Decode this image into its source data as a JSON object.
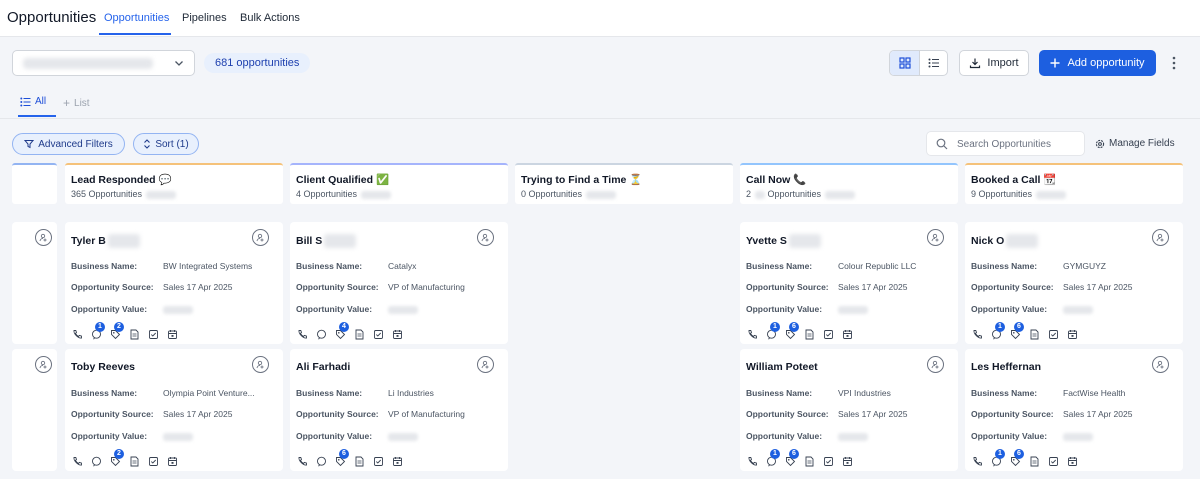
{
  "header": {
    "title": "Opportunities",
    "tabs": [
      {
        "label": "Opportunities",
        "active": true
      },
      {
        "label": "Pipelines",
        "active": false
      },
      {
        "label": "Bulk Actions",
        "active": false
      }
    ]
  },
  "toolbar": {
    "count_label": "681 opportunities",
    "import_label": "Import",
    "add_label": "Add opportunity"
  },
  "views": {
    "all_label": "All",
    "list_label": "List"
  },
  "filters": {
    "advanced_label": "Advanced Filters",
    "sort_label": "Sort (1)",
    "search_placeholder": "Search Opportunities",
    "manage_fields_label": "Manage Fields"
  },
  "field_labels": {
    "business_name": "Business Name:",
    "opportunity_source": "Opportunity Source:",
    "opportunity_value": "Opportunity Value:"
  },
  "stages": [
    {
      "name": "Lead Responded",
      "emoji": "💬",
      "count_text": "365 Opportunities"
    },
    {
      "name": "Client Qualified",
      "emoji": "✅",
      "count_text": "4 Opportunities"
    },
    {
      "name": "Trying to Find a Time",
      "emoji": "⏳",
      "count_text": "0 Opportunities"
    },
    {
      "name": "Call Now",
      "emoji": "📞",
      "count_text": "2",
      "count_suffix": "Opportunities"
    },
    {
      "name": "Booked a Call",
      "emoji": "📆",
      "count_text": "9",
      "count_suffix": "Opportunities"
    }
  ],
  "cards": {
    "col0_row0": {
      "name": "Tyler B",
      "business": "BW Integrated Systems",
      "source": "Sales 17 Apr 2025",
      "badges": [
        "",
        "1",
        "2",
        "",
        "",
        ""
      ]
    },
    "col0_row1": {
      "name": "Toby Reeves",
      "business": "Olympia Point Venture...",
      "source": "Sales 17 Apr 2025",
      "badges": [
        "",
        "",
        "2",
        "",
        "",
        ""
      ]
    },
    "col1_row0": {
      "name": "Bill S",
      "business": "Catalyx",
      "source": "VP of Manufacturing",
      "badges": [
        "",
        "",
        "4",
        "",
        "",
        ""
      ]
    },
    "col1_row1": {
      "name": "Ali Farhadi",
      "business": "Li Industries",
      "source": "VP of Manufacturing",
      "badges": [
        "",
        "",
        "6",
        "",
        "",
        ""
      ]
    },
    "col3_row0": {
      "name": "Yvette S",
      "business": "Colour Republic LLC",
      "source": "Sales 17 Apr 2025",
      "badges": [
        "",
        "1",
        "6",
        "",
        "",
        ""
      ]
    },
    "col3_row1": {
      "name": "William Poteet",
      "business": "VPI Industries",
      "source": "Sales 17 Apr 2025",
      "badges": [
        "",
        "1",
        "6",
        "",
        "",
        ""
      ]
    },
    "col4_row0": {
      "name": "Nick O",
      "business": "GYMGUYZ",
      "source": "Sales 17 Apr 2025",
      "badges": [
        "",
        "1",
        "6",
        "",
        "",
        ""
      ]
    },
    "col4_row1": {
      "name": "Les Heffernan",
      "business": "FactWise Health",
      "source": "Sales 17 Apr 2025",
      "badges": [
        "",
        "1",
        "6",
        "",
        "",
        ""
      ]
    }
  },
  "colors": {
    "accent": "#1d5fe0",
    "stage_border": "#f5c27a",
    "badge": "#1d5fe0"
  }
}
